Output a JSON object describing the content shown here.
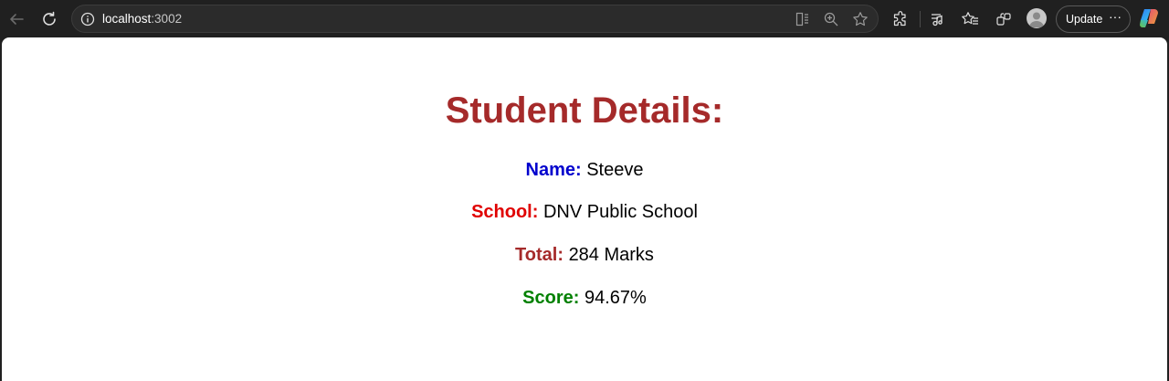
{
  "browser": {
    "url_host": "localhost",
    "url_port": ":3002",
    "update_label": "Update",
    "more_label": "···"
  },
  "page": {
    "heading": "Student Details:",
    "fields": [
      {
        "label": "Name:",
        "value": "Steeve",
        "color": "#0000cd"
      },
      {
        "label": "School:",
        "value": "DNV Public School",
        "color": "#e00000"
      },
      {
        "label": "Total:",
        "value": "284 Marks",
        "color": "#a52a2a"
      },
      {
        "label": "Score:",
        "value": "94.67%",
        "color": "#008000"
      }
    ],
    "heading_color": "#a52a2a"
  },
  "icons": [
    "back-icon",
    "reload-icon",
    "info-icon",
    "reader-icon",
    "zoom-icon",
    "favorite-star-icon",
    "extensions-icon",
    "media-icon",
    "favorites-icon",
    "collections-icon",
    "profile-avatar",
    "copilot-icon"
  ]
}
